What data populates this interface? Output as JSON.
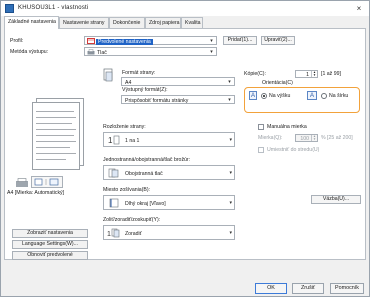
{
  "window": {
    "title": "KHUSOU3L1 - vlastnosti",
    "close": "×"
  },
  "tabs": [
    {
      "label": "Základné nastavenia"
    },
    {
      "label": "Nastavenie strany"
    },
    {
      "label": "Dokončenie"
    },
    {
      "label": "Zdroj papiera"
    },
    {
      "label": "Kvalita"
    }
  ],
  "profile": {
    "label": "Profil:",
    "value": "Predvolené nastavenia",
    "add": "Pridať(1)...",
    "edit": "Upraviť(2)..."
  },
  "output_method": {
    "label": "Metóda výstupu:",
    "value": "Tlač"
  },
  "page_size": {
    "label": "Formát strany:",
    "value": "A4"
  },
  "output_size": {
    "label": "Výstupný formát(Z):",
    "value": "Prispôsobiť formátu stránky"
  },
  "copies": {
    "label": "Kópie(C):",
    "value": "1",
    "range": "[1 až 99]"
  },
  "orientation": {
    "label": "Orientácia(C)",
    "portrait": "Na výšku",
    "landscape": "Na šírku",
    "selected": "portrait"
  },
  "layout": {
    "label": "Rozloženie strany:",
    "value": "1 na 1"
  },
  "manual_scaling": {
    "label": "Manuálna mierka",
    "scale_label": "Mierka(Q):",
    "scale_value": "100",
    "scale_range": "% [25 až 200]",
    "watermark_label": "Umiestniť do stredu(U)"
  },
  "duplex": {
    "label": "Jednostranná/obojstranná/tlač brožúr:",
    "value": "Obojstranná tlač"
  },
  "binding": {
    "label": "Miesto zošívania(B):",
    "value": "Dlhý okraj [Vľavo]",
    "gutter": "Väzba(U)..."
  },
  "finishing": {
    "label": "Zoliť/zoradiť/zoskupiť(Y):",
    "value": "Zoradiť"
  },
  "preview": {
    "caption": "A4 [Mierka: Automatický]"
  },
  "left_buttons": [
    {
      "label": "Zobraziť nastavenia"
    },
    {
      "label": "Language Settings(W)..."
    },
    {
      "label": "Obnoviť predvolené"
    }
  ],
  "footer": {
    "ok": "OK",
    "cancel": "Zrušiť",
    "help": "Pomocník"
  }
}
